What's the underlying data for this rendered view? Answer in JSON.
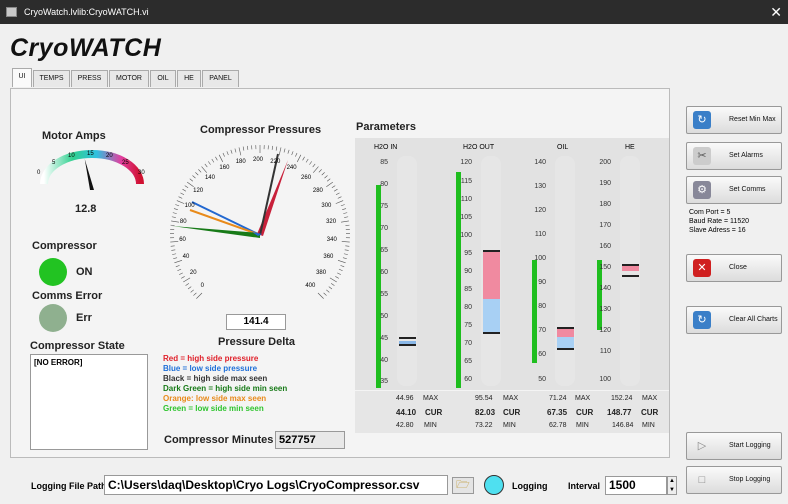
{
  "window": {
    "title": "CryoWatch.lvlib:CryoWATCH.vi"
  },
  "app_title": "CryoWATCH",
  "tabs": [
    "UI",
    "TEMPS",
    "PRESS",
    "MOTOR",
    "OIL",
    "HE",
    "PANEL"
  ],
  "motor": {
    "title": "Motor Amps",
    "value": "12.8",
    "ticks": [
      "0",
      "5",
      "10",
      "15",
      "20",
      "25",
      "30"
    ],
    "level": 12.8,
    "max": 30
  },
  "compressor": {
    "label": "Compressor",
    "status": "ON",
    "color": "#22c322"
  },
  "comms": {
    "label": "Comms Error",
    "status": "Err",
    "color": "#8fb08f"
  },
  "state": {
    "label": "Compressor State",
    "text": "[NO ERROR]"
  },
  "pressures": {
    "title": "Compressor Pressures",
    "ticks": [
      "0",
      "20",
      "40",
      "60",
      "80",
      "100",
      "120",
      "140",
      "160",
      "180",
      "200",
      "220",
      "240",
      "260",
      "280",
      "300",
      "320",
      "340",
      "360",
      "380",
      "400"
    ],
    "delta_value": "141.4",
    "delta_label": "Pressure Delta"
  },
  "legend": [
    {
      "text": "Red = high side pressure",
      "color": "#e0202a"
    },
    {
      "text": "Blue = low side pressure",
      "color": "#1e6fd8"
    },
    {
      "text": "Black = high side max seen",
      "color": "#333333"
    },
    {
      "text": "Dark Green = high side min seen",
      "color": "#177a17"
    },
    {
      "text": "Orange: low side max seen",
      "color": "#e88a1a"
    },
    {
      "text": "Green = low side min seen",
      "color": "#2ec42e"
    }
  ],
  "minutes": {
    "label": "Compressor Minutes",
    "value": "527757"
  },
  "params": {
    "title": "Parameters",
    "columns": [
      {
        "name": "H2O IN",
        "ticks": [
          "85",
          "80",
          "75",
          "70",
          "65",
          "60",
          "55",
          "50",
          "45",
          "40",
          "35"
        ],
        "max": "44.96",
        "cur": "44.10",
        "min": "42.80"
      },
      {
        "name": "H2O OUT",
        "ticks": [
          "120",
          "115",
          "110",
          "105",
          "100",
          "95",
          "90",
          "85",
          "80",
          "75",
          "70",
          "65",
          "60"
        ],
        "max": "95.54",
        "cur": "82.03",
        "min": "73.22"
      },
      {
        "name": "OIL",
        "ticks": [
          "140",
          "130",
          "120",
          "110",
          "100",
          "90",
          "80",
          "70",
          "60",
          "50"
        ],
        "max": "71.24",
        "cur": "67.35",
        "min": "62.78"
      },
      {
        "name": "HE",
        "ticks": [
          "200",
          "190",
          "180",
          "170",
          "160",
          "150",
          "140",
          "130",
          "120",
          "110",
          "100"
        ],
        "max": "152.24",
        "cur": "148.77",
        "min": "146.84"
      }
    ],
    "max_label": "MAX",
    "cur_label": "CUR",
    "min_label": "MIN"
  },
  "buttons": {
    "reset": "Reset Min Max",
    "alarms": "Set Alarms",
    "comms": "Set Comms",
    "close": "Close",
    "clear": "Clear All Charts",
    "start": "Start Logging",
    "stop": "Stop Logging"
  },
  "comm_info": {
    "port": "Com Port =  5",
    "baud": "Baud Rate = 11520",
    "slave": "Slave Adress = 16"
  },
  "logging": {
    "path_label": "Logging File Path",
    "path": "C:\\Users\\daq\\Desktop\\Cryo Logs\\CryoCompressor.csv",
    "status_label": "Logging",
    "interval_label": "Interval",
    "interval": "1500"
  }
}
